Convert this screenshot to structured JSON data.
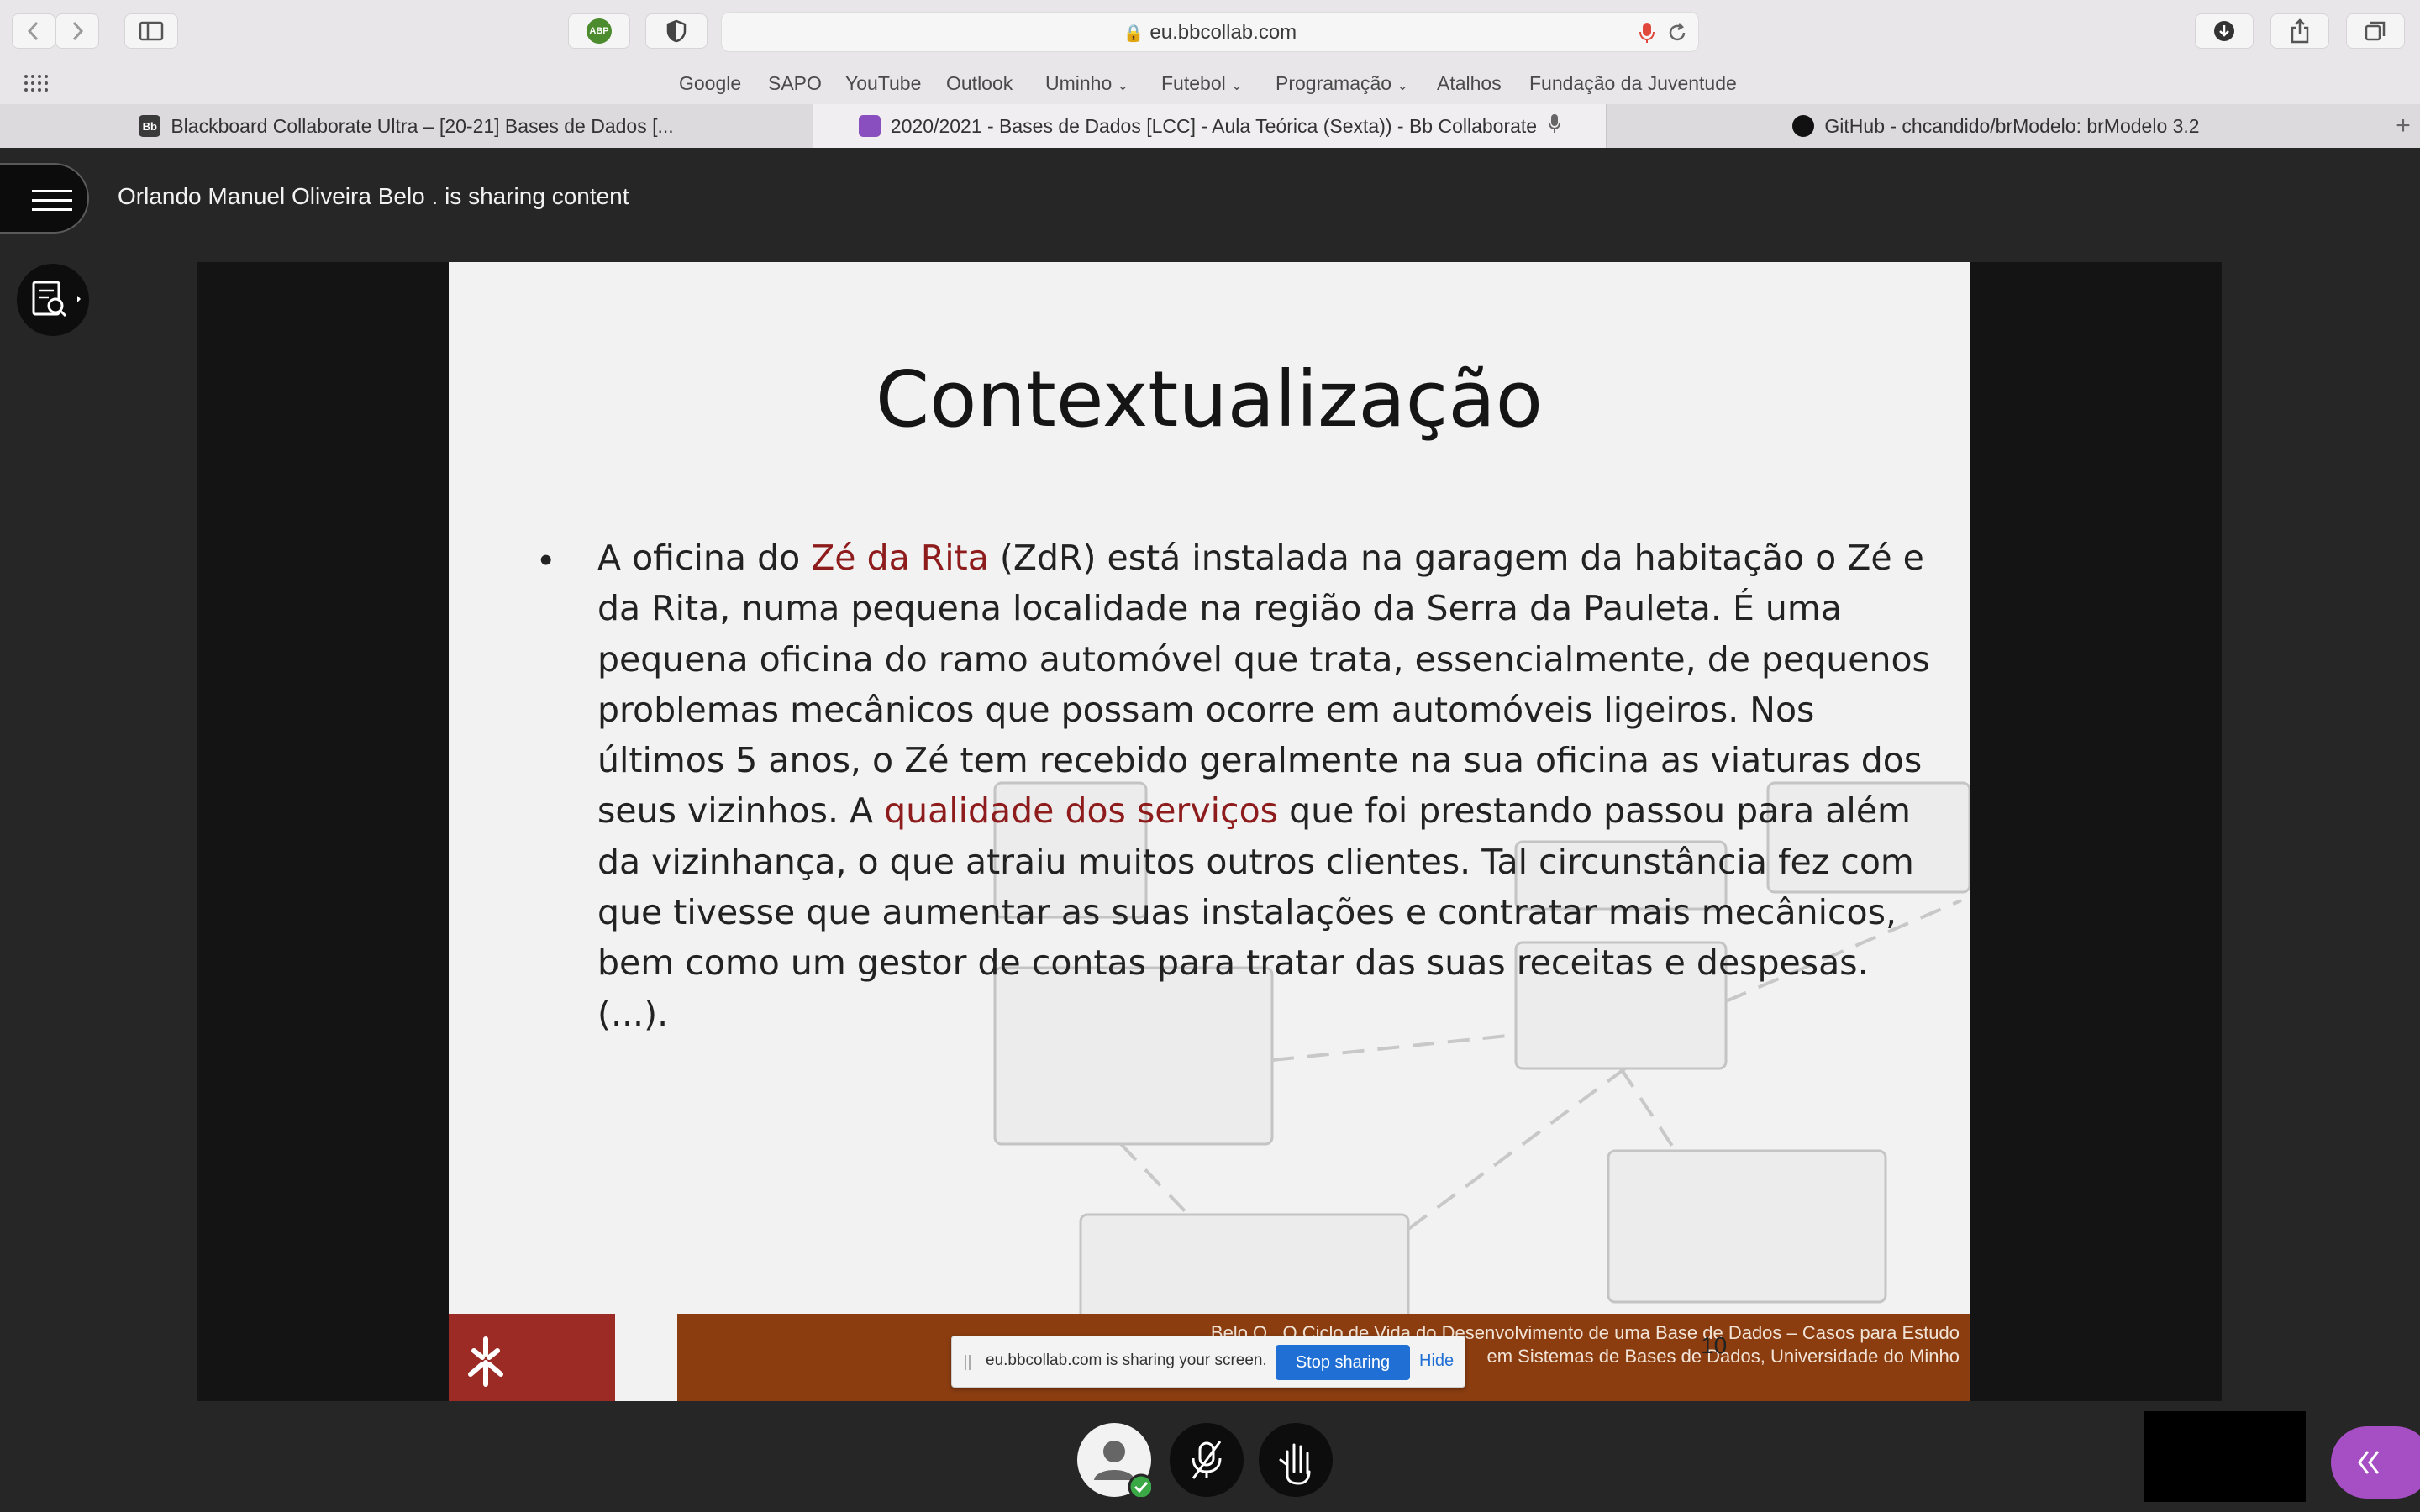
{
  "browser": {
    "url": "eu.bbcollab.com",
    "adblock_badge": "ABP",
    "bookmarks": [
      "Google",
      "SAPO",
      "YouTube",
      "Outlook",
      "Uminho",
      "Futebol",
      "Programação",
      "Atalhos",
      "Fundação da Juventude"
    ],
    "tabs": [
      {
        "label": "Blackboard Collaborate Ultra – [20-21] Bases de Dados [...",
        "favicon": "blackboard-icon"
      },
      {
        "label": "2020/2021 - Bases de Dados [LCC] - Aula Teórica (Sexta)) - Bb Collaborate",
        "favicon": "collaborate-icon"
      },
      {
        "label": "GitHub - chcandido/brModelo: brModelo 3.2",
        "favicon": "github-icon"
      }
    ]
  },
  "session": {
    "sharing_title": "Orlando Manuel Oliveira Belo . is sharing content"
  },
  "slide": {
    "title": "Contextualização",
    "bullet": "•",
    "text_parts": [
      "A oficina do ",
      "Zé da Rita",
      " (ZdR) está instalada na garagem da habitação o Zé e da Rita, numa pequena localidade na região da Serra da Pauleta. É uma pequena oficina do ramo automóvel que trata, essencialmente, de pequenos problemas mecânicos que possam ocorre em automóveis ligeiros. Nos últimos 5 anos, o Zé tem recebido geralmente na sua oficina as viaturas dos seus vizinhos. A ",
      "qualidade dos serviços",
      " que foi prestando passou para além da vizinhança, o que atraiu muitos outros clientes. Tal circunstância fez com que tivesse que aumentar as suas instalações e contratar mais mecânicos, bem como um gestor de contas para tratar das suas receitas e despesas. (...)."
    ],
    "footer_line1": "Belo O., O Ciclo de Vida do Desenvolvimento de uma Base de Dados – Casos para Estudo",
    "footer_line2": "em Sistemas de Bases de Dados, Universidade do Minho",
    "page_number": "10"
  },
  "share_notice": {
    "message": "eu.bbcollab.com is sharing your screen.",
    "stop_label": "Stop sharing",
    "hide_label": "Hide"
  },
  "colors": {
    "highlight": "#8e1c1c",
    "footer_brown": "#8b3d10",
    "uminho_red": "#9c2a25",
    "collapse_purple": "#a64fc4",
    "stop_blue": "#1f6fd4"
  }
}
